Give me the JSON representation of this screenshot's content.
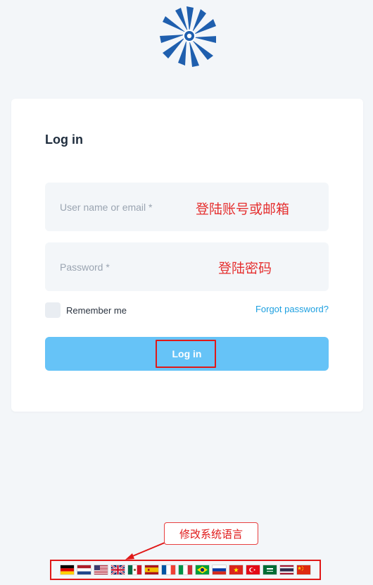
{
  "brand": {
    "logo_icon": "brand-logo-icon",
    "color": "#1f5fae"
  },
  "login": {
    "title": "Log in",
    "username_placeholder": "User name or email *",
    "password_placeholder": "Password *",
    "remember_label": "Remember me",
    "forgot_label": "Forgot password?",
    "submit_label": "Log in"
  },
  "annotations": {
    "username_note": "登陆账号或邮箱",
    "password_note": "登陆密码",
    "language_note": "修改系统语言"
  },
  "languages": [
    {
      "name": "German",
      "icon": "flag-de"
    },
    {
      "name": "Dutch",
      "icon": "flag-nl"
    },
    {
      "name": "US English",
      "icon": "flag-us"
    },
    {
      "name": "UK English",
      "icon": "flag-gb"
    },
    {
      "name": "Mexican Spanish",
      "icon": "flag-mx"
    },
    {
      "name": "Spanish",
      "icon": "flag-es"
    },
    {
      "name": "French",
      "icon": "flag-fr"
    },
    {
      "name": "Italian",
      "icon": "flag-it"
    },
    {
      "name": "Brazilian Portuguese",
      "icon": "flag-br"
    },
    {
      "name": "Russian",
      "icon": "flag-ru"
    },
    {
      "name": "Vietnamese",
      "icon": "flag-vn"
    },
    {
      "name": "Turkish",
      "icon": "flag-tr"
    },
    {
      "name": "Arabic",
      "icon": "flag-sa"
    },
    {
      "name": "Thai",
      "icon": "flag-th"
    },
    {
      "name": "Chinese",
      "icon": "flag-cn"
    }
  ],
  "colors": {
    "accent": "#66c3f7",
    "link": "#1ea0e0",
    "annotation": "#e01818",
    "background": "#f3f6f9"
  }
}
